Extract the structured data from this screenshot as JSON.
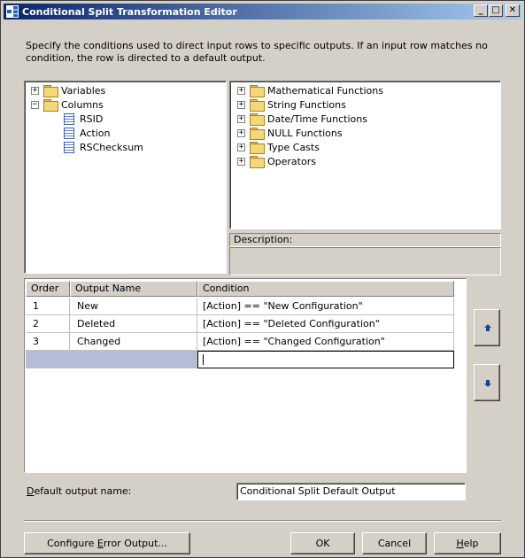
{
  "window": {
    "title": "Conditional Split Transformation Editor",
    "minimize": "_",
    "maximize": "□",
    "close": "✕"
  },
  "description": "Specify the conditions used to direct input rows to specific outputs. If an input row matches no condition, the row is directed to a default output.",
  "left_tree": {
    "variables": "Variables",
    "columns": "Columns",
    "column_items": [
      "RSID",
      "Action",
      "RSChecksum"
    ],
    "collapsed_sign": "+",
    "expanded_sign": "−"
  },
  "right_tree": {
    "items": [
      "Mathematical Functions",
      "String Functions",
      "Date/Time Functions",
      "NULL Functions",
      "Type Casts",
      "Operators"
    ]
  },
  "description_panel": {
    "label": "Description:"
  },
  "grid": {
    "headers": {
      "order": "Order",
      "output_name": "Output Name",
      "condition": "Condition"
    },
    "rows": [
      {
        "order": "1",
        "output_name": "New",
        "condition": "[Action] ==  \"New Configuration\""
      },
      {
        "order": "2",
        "output_name": "Deleted",
        "condition": "[Action] ==  \"Deleted Configuration\""
      },
      {
        "order": "3",
        "output_name": "Changed",
        "condition": "[Action] ==  \"Changed Configuration\""
      }
    ]
  },
  "default_output": {
    "label_prefix": "",
    "label_underlined": "D",
    "label_rest": "efault output name:",
    "value": "Conditional Split Default Output"
  },
  "buttons": {
    "configure_prefix": "Configure ",
    "configure_underlined": "E",
    "configure_rest": "rror Output...",
    "ok": "OK",
    "cancel": "Cancel",
    "help_underlined": "H",
    "help_rest": "elp"
  },
  "colors": {
    "titlebar_start": "#0a246a",
    "titlebar_end": "#a6caf0",
    "dialog_bg": "#d4d0c8",
    "new_row": "#b4bcd8"
  }
}
